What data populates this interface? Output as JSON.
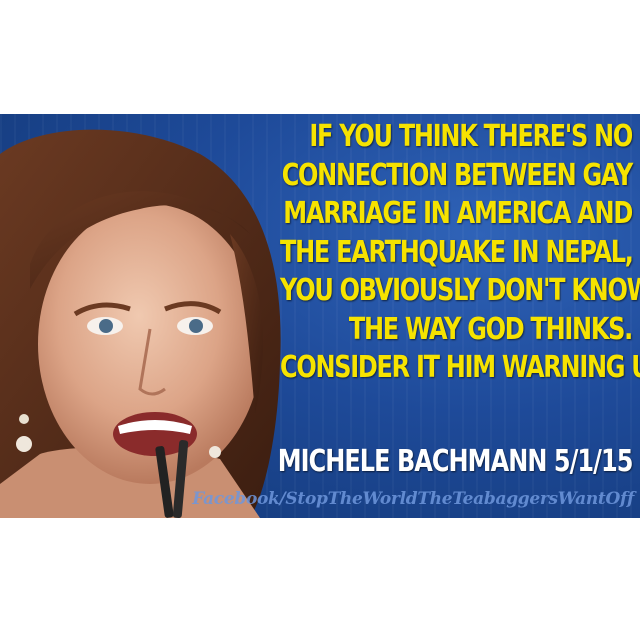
{
  "quote": {
    "lines": [
      "IF YOU THINK THERE'S NO",
      "CONNECTION BETWEEN GAY",
      "MARRIAGE IN AMERICA AND",
      "THE EARTHQUAKE IN NEPAL,",
      "YOU OBVIOUSLY DON'T KNOW",
      "THE WAY GOD THINKS.",
      "CONSIDER IT HIM WARNING US."
    ]
  },
  "attribution": "MICHELE BACHMANN 5/1/15",
  "watermark": "Facebook/StopTheWorldTheTeabaggersWantOff",
  "colors": {
    "background": "#1e4a99",
    "quote_text": "#f6e300",
    "attribution_text": "#ffffff",
    "page": "#ffffff"
  }
}
